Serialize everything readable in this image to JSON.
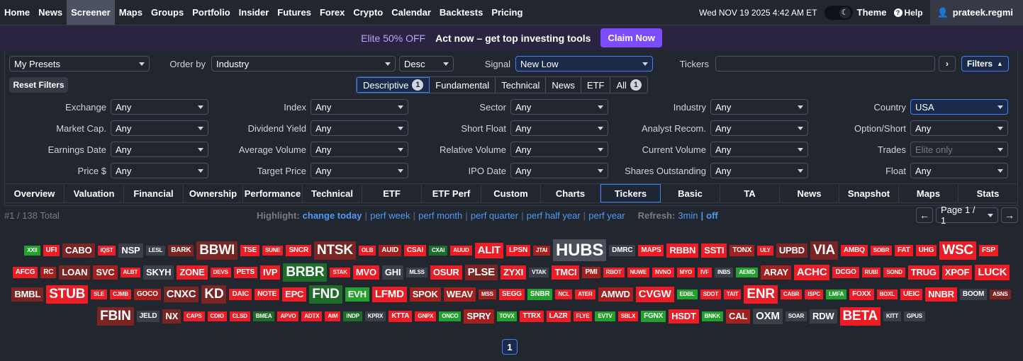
{
  "nav": {
    "items": [
      "Home",
      "News",
      "Screener",
      "Maps",
      "Groups",
      "Portfolio",
      "Insider",
      "Futures",
      "Forex",
      "Crypto",
      "Calendar",
      "Backtests",
      "Pricing"
    ],
    "active": "Screener",
    "date": "Wed NOV 19 2025 4:42 AM ET",
    "theme": "Theme",
    "help": "Help",
    "user": "prateek.regmi"
  },
  "banner": {
    "elite": "Elite 50% OFF",
    "act": "Act now – get top investing tools",
    "claim": "Claim Now"
  },
  "controls": {
    "presets": "My Presets",
    "order_label": "Order by",
    "order": "Industry",
    "dir": "Desc",
    "signal_label": "Signal",
    "signal": "New Low",
    "tickers_label": "Tickers",
    "filters": "Filters",
    "reset": "Reset Filters"
  },
  "filter_tabs": [
    {
      "label": "Descriptive",
      "badge": "1"
    },
    {
      "label": "Fundamental"
    },
    {
      "label": "Technical"
    },
    {
      "label": "News"
    },
    {
      "label": "ETF"
    },
    {
      "label": "All",
      "badge": "1"
    }
  ],
  "filters": [
    [
      {
        "label": "Exchange",
        "value": "Any"
      },
      {
        "label": "Index",
        "value": "Any"
      },
      {
        "label": "Sector",
        "value": "Any"
      },
      {
        "label": "Industry",
        "value": "Any"
      },
      {
        "label": "Country",
        "value": "USA"
      }
    ],
    [
      {
        "label": "Market Cap.",
        "value": "Any"
      },
      {
        "label": "Dividend Yield",
        "value": "Any"
      },
      {
        "label": "Short Float",
        "value": "Any"
      },
      {
        "label": "Analyst Recom.",
        "value": "Any"
      },
      {
        "label": "Option/Short",
        "value": "Any"
      }
    ],
    [
      {
        "label": "Earnings Date",
        "value": "Any"
      },
      {
        "label": "Average Volume",
        "value": "Any"
      },
      {
        "label": "Relative Volume",
        "value": "Any"
      },
      {
        "label": "Current Volume",
        "value": "Any"
      },
      {
        "label": "Trades",
        "value": "Elite only"
      }
    ],
    [
      {
        "label": "Price $",
        "value": "Any"
      },
      {
        "label": "Target Price",
        "value": "Any"
      },
      {
        "label": "IPO Date",
        "value": "Any"
      },
      {
        "label": "Shares Outstanding",
        "value": "Any"
      },
      {
        "label": "Float",
        "value": "Any"
      }
    ]
  ],
  "view_tabs": [
    "Overview",
    "Valuation",
    "Financial",
    "Ownership",
    "Performance",
    "Technical",
    "ETF",
    "ETF Perf",
    "Custom",
    "Charts",
    "Tickers",
    "Basic",
    "TA",
    "News",
    "Snapshot",
    "Maps",
    "Stats"
  ],
  "active_view": "Tickers",
  "status": {
    "total": "#1 / 138 Total",
    "highlight": "Highlight:",
    "change_today": "change today",
    "perf_week": "perf week",
    "perf_month": "perf month",
    "perf_quarter": "perf quarter",
    "perf_half": "perf half year",
    "perf_year": "perf year",
    "refresh": "Refresh:",
    "refresh_3min": "3min",
    "refresh_off": "off",
    "page": "Page 1 / 1"
  },
  "tickers": [
    [
      [
        "XXII",
        "g",
        1
      ],
      [
        "UFI",
        "r",
        2
      ],
      [
        "CABO",
        "br",
        3
      ],
      [
        "IQST",
        "r",
        1
      ],
      [
        "NSP",
        "dk",
        3
      ],
      [
        "LESL",
        "dk",
        1
      ],
      [
        "BARK",
        "br",
        2
      ],
      [
        "BBWI",
        "br",
        5
      ],
      [
        "TSE",
        "r",
        2
      ],
      [
        "SUNE",
        "r",
        1
      ],
      [
        "SNCR",
        "r",
        2
      ],
      [
        "NTSK",
        "br",
        5
      ],
      [
        "OLB",
        "r",
        1
      ],
      [
        "AUID",
        "dr",
        2
      ],
      [
        "CSAI",
        "r",
        2
      ],
      [
        "CXAI",
        "dg",
        1
      ],
      [
        "AUUD",
        "r",
        1
      ],
      [
        "ALIT",
        "r",
        4
      ],
      [
        "LPSN",
        "r",
        2
      ],
      [
        "JTAI",
        "dr",
        1
      ],
      [
        "HUBS",
        "gr",
        6
      ],
      [
        "DMRC",
        "dk",
        2
      ],
      [
        "MAPS",
        "r",
        2
      ],
      [
        "RBBN",
        "r",
        3
      ],
      [
        "SSTI",
        "r",
        3
      ],
      [
        "TONX",
        "dr",
        2
      ],
      [
        "ULY",
        "r",
        1
      ],
      [
        "UPBD",
        "br",
        3
      ],
      [
        "VIA",
        "br",
        5
      ],
      [
        "AMBQ",
        "r",
        2
      ],
      [
        "SOBR",
        "r",
        1
      ],
      [
        "FAT",
        "r",
        2
      ],
      [
        "UHG",
        "r",
        2
      ],
      [
        "WSC",
        "r",
        5
      ],
      [
        "FSP",
        "r",
        2
      ]
    ],
    [
      [
        "AFCG",
        "r",
        2
      ],
      [
        "RC",
        "dr",
        2
      ],
      [
        "LOAN",
        "br",
        3
      ],
      [
        "SVC",
        "dr",
        3
      ],
      [
        "ALBT",
        "r",
        1
      ],
      [
        "SKYH",
        "dk",
        3
      ],
      [
        "ZONE",
        "r",
        3
      ],
      [
        "DEVS",
        "r",
        1
      ],
      [
        "PETS",
        "r",
        2
      ],
      [
        "IVP",
        "r",
        3
      ],
      [
        "BRBR",
        "dg",
        5
      ],
      [
        "STAK",
        "r",
        1
      ],
      [
        "MVO",
        "r",
        3
      ],
      [
        "GHI",
        "dk",
        3
      ],
      [
        "MLSS",
        "dk",
        1
      ],
      [
        "OSUR",
        "r",
        3
      ],
      [
        "PLSE",
        "br",
        4
      ],
      [
        "ZYXI",
        "r",
        3
      ],
      [
        "VTAK",
        "dk",
        1
      ],
      [
        "TMCI",
        "r",
        3
      ],
      [
        "PMI",
        "dr",
        2
      ],
      [
        "RBOT",
        "r",
        1
      ],
      [
        "NUWE",
        "r",
        1
      ],
      [
        "NVNO",
        "r",
        1
      ],
      [
        "MYO",
        "r",
        1
      ],
      [
        "IVF",
        "r",
        1
      ],
      [
        "INBS",
        "dk",
        1
      ],
      [
        "AEMD",
        "g",
        1
      ],
      [
        "ARAY",
        "dr",
        3
      ],
      [
        "ACHC",
        "r",
        4
      ],
      [
        "DCGO",
        "r",
        2
      ],
      [
        "RUBI",
        "r",
        1
      ],
      [
        "SOND",
        "r",
        1
      ],
      [
        "TRUG",
        "r",
        3
      ],
      [
        "XPOF",
        "r",
        3
      ],
      [
        "LUCK",
        "r",
        4
      ]
    ],
    [
      [
        "BMBL",
        "br",
        3
      ],
      [
        "STUB",
        "r",
        5
      ],
      [
        "SLE",
        "r",
        1
      ],
      [
        "CJMB",
        "r",
        1
      ],
      [
        "GOCO",
        "dr",
        2
      ],
      [
        "CNXC",
        "br",
        4
      ],
      [
        "KD",
        "br",
        5
      ],
      [
        "DAIC",
        "r",
        2
      ],
      [
        "NOTE",
        "r",
        2
      ],
      [
        "EPC",
        "r",
        3
      ],
      [
        "FND",
        "dg",
        5
      ],
      [
        "EVH",
        "g",
        3
      ],
      [
        "LFMD",
        "r",
        4
      ],
      [
        "SPOK",
        "dr",
        3
      ],
      [
        "WEAV",
        "dr",
        3
      ],
      [
        "MSS",
        "dr",
        1
      ],
      [
        "SEGG",
        "r",
        2
      ],
      [
        "SNBR",
        "g",
        2
      ],
      [
        "NCL",
        "r",
        1
      ],
      [
        "ATER",
        "r",
        1
      ],
      [
        "AMWD",
        "dr",
        3
      ],
      [
        "CVGW",
        "r",
        4
      ],
      [
        "EDBL",
        "g",
        1
      ],
      [
        "SDOT",
        "r",
        1
      ],
      [
        "TAIT",
        "r",
        1
      ],
      [
        "ENR",
        "r",
        5
      ],
      [
        "CABR",
        "r",
        1
      ],
      [
        "ISPC",
        "r",
        1
      ],
      [
        "LMFA",
        "g",
        1
      ],
      [
        "FOXX",
        "r",
        2
      ],
      [
        "BOXL",
        "r",
        1
      ],
      [
        "UEIC",
        "r",
        2
      ],
      [
        "NNBR",
        "r",
        3
      ],
      [
        "BOOM",
        "dk",
        2
      ],
      [
        "ASNS",
        "br",
        1
      ]
    ],
    [
      [
        "FBIN",
        "br",
        5
      ],
      [
        "JELD",
        "dk",
        2
      ],
      [
        "NX",
        "br",
        3
      ],
      [
        "CAPS",
        "r",
        1
      ],
      [
        "CDIO",
        "r",
        1
      ],
      [
        "CLSD",
        "r",
        1
      ],
      [
        "BMEA",
        "dg",
        1
      ],
      [
        "APVO",
        "r",
        1
      ],
      [
        "ADTX",
        "r",
        1
      ],
      [
        "AIM",
        "r",
        1
      ],
      [
        "INDP",
        "dg",
        1
      ],
      [
        "KPRX",
        "dk",
        1
      ],
      [
        "KTTA",
        "r",
        2
      ],
      [
        "GNPX",
        "r",
        1
      ],
      [
        "ONCO",
        "g",
        1
      ],
      [
        "SPRY",
        "dr",
        3
      ],
      [
        "TOVX",
        "g",
        1
      ],
      [
        "TTRX",
        "r",
        2
      ],
      [
        "LAZR",
        "r",
        2
      ],
      [
        "FLYE",
        "r",
        1
      ],
      [
        "EVTV",
        "g",
        1
      ],
      [
        "SBLX",
        "r",
        1
      ],
      [
        "FGNX",
        "g",
        2
      ],
      [
        "HSDT",
        "r",
        3
      ],
      [
        "BNKK",
        "g",
        1
      ],
      [
        "CAL",
        "dr",
        3
      ],
      [
        "OXM",
        "dk",
        4
      ],
      [
        "SOAR",
        "dk",
        1
      ],
      [
        "RDW",
        "dk",
        3
      ],
      [
        "BETA",
        "r",
        5
      ],
      [
        "KITT",
        "dk",
        1
      ],
      [
        "GPUS",
        "dk",
        1
      ]
    ]
  ],
  "page_number": "1"
}
